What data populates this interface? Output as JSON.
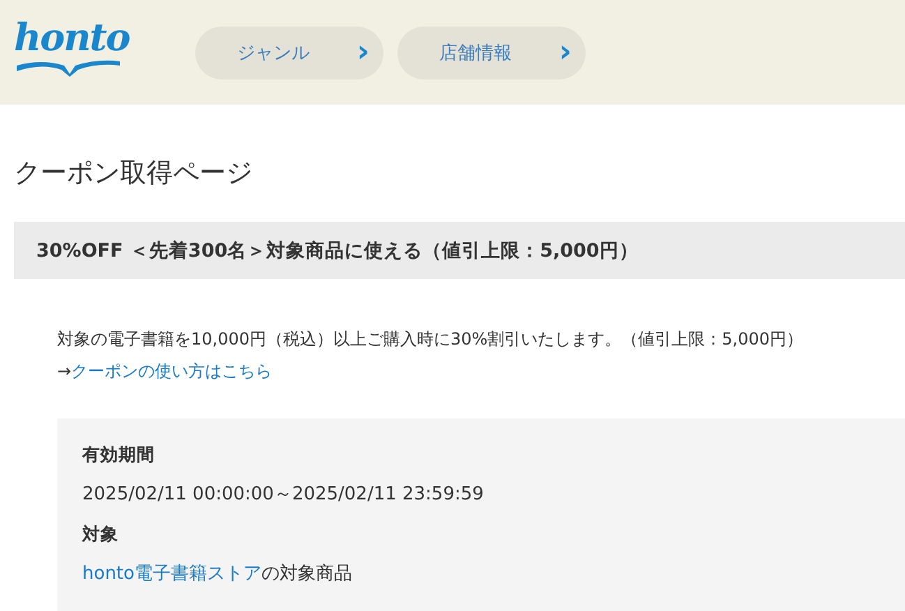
{
  "header": {
    "logo": "honto",
    "nav": [
      {
        "label": "ジャンル",
        "glyph": "›"
      },
      {
        "label": "店舗情報",
        "glyph": "›"
      }
    ]
  },
  "page_title": "クーポン取得ページ",
  "coupon": {
    "title": "30%OFF ＜先着300名＞対象商品に使える（値引上限：5,000円）",
    "description": "対象の電子書籍を10,000円（税込）以上ご購入時に30%割引いたします。（値引上限：5,000円）",
    "howto": {
      "prefix": "→",
      "link": "クーポンの使い方はこちら"
    },
    "details": [
      {
        "kind": "heading",
        "text": "有効期間"
      },
      {
        "kind": "text",
        "text": "2025/02/11 00:00:00～2025/02/11 23:59:59"
      },
      {
        "kind": "heading",
        "text": "対象"
      },
      {
        "kind": "linked",
        "link": "honto電子書籍ストア",
        "text": "の対象商品"
      }
    ]
  }
}
